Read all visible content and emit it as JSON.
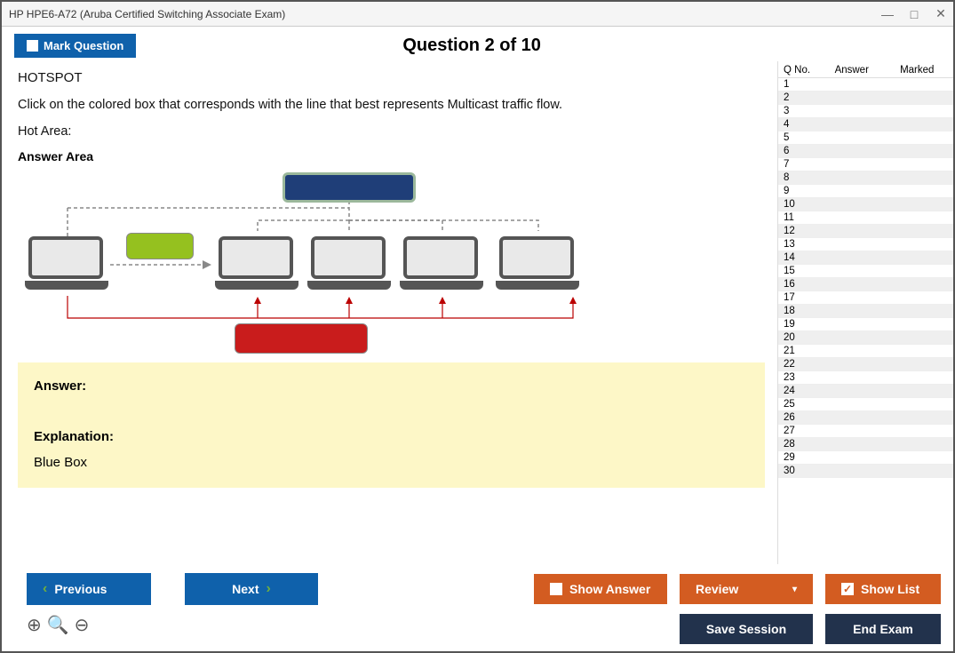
{
  "window": {
    "title": "HP HPE6-A72 (Aruba Certified Switching Associate Exam)"
  },
  "header": {
    "mark_label": "Mark Question",
    "question_title": "Question 2 of 10"
  },
  "question": {
    "type_line": "HOTSPOT",
    "body_line": "Click on the colored box that corresponds with the line that best represents Multicast traffic flow.",
    "hot_area_line": "Hot Area:",
    "answer_area_label": "Answer Area"
  },
  "answer_card": {
    "answer_heading": "Answer:",
    "explanation_heading": "Explanation:",
    "explanation_body": "Blue Box"
  },
  "nav_table": {
    "col_qno": "Q No.",
    "col_answer": "Answer",
    "col_marked": "Marked",
    "rows": [
      1,
      2,
      3,
      4,
      5,
      6,
      7,
      8,
      9,
      10,
      11,
      12,
      13,
      14,
      15,
      16,
      17,
      18,
      19,
      20,
      21,
      22,
      23,
      24,
      25,
      26,
      27,
      28,
      29,
      30
    ]
  },
  "footer": {
    "previous": "Previous",
    "next": "Next",
    "show_answer": "Show Answer",
    "review": "Review",
    "show_list": "Show List",
    "save_session": "Save Session",
    "end_exam": "End Exam"
  }
}
